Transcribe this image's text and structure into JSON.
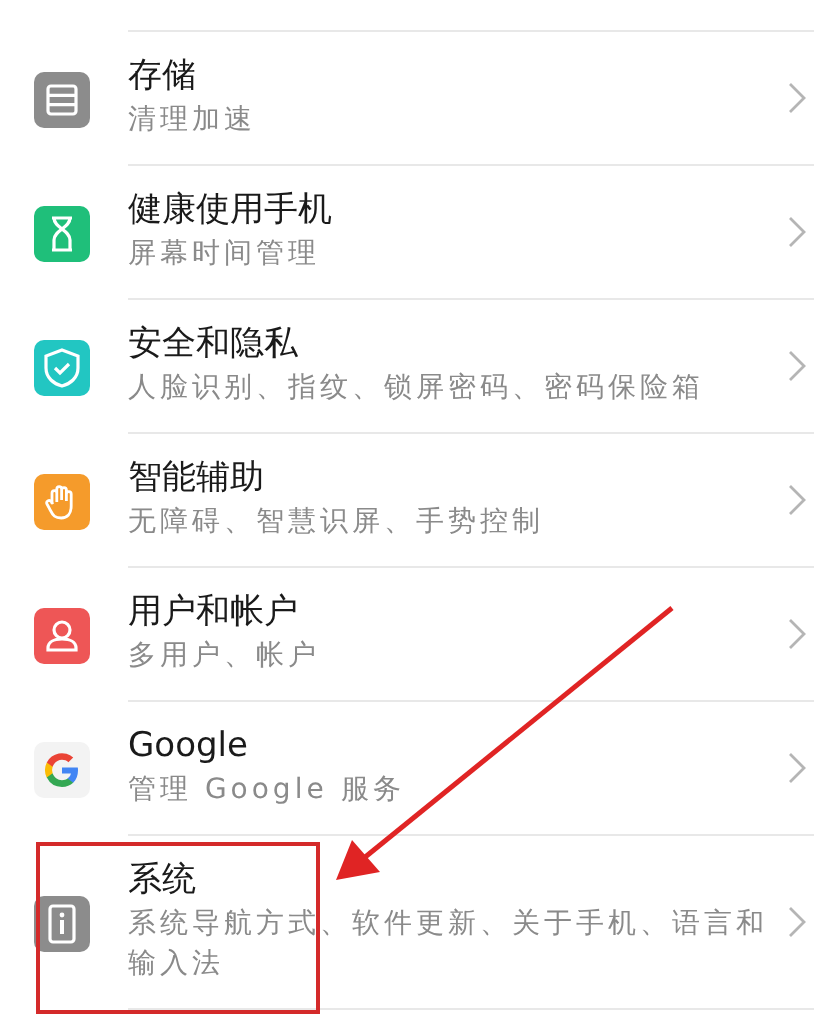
{
  "settings_items": [
    {
      "title": "存储",
      "subtitle": "清理加速",
      "highlighted": false
    },
    {
      "title": "健康使用手机",
      "subtitle": "屏幕时间管理",
      "highlighted": false
    },
    {
      "title": "安全和隐私",
      "subtitle": "人脸识别、指纹、锁屏密码、密码保险箱",
      "highlighted": false
    },
    {
      "title": "智能辅助",
      "subtitle": "无障碍、智慧识屏、手势控制",
      "highlighted": false
    },
    {
      "title": "用户和帐户",
      "subtitle": "多用户、帐户",
      "highlighted": false
    },
    {
      "title": "Google",
      "subtitle": "管理 Google 服务",
      "highlighted": false
    },
    {
      "title": "系统",
      "subtitle": "系统导航方式、软件更新、关于手机、语言和输入法",
      "highlighted": true
    }
  ]
}
